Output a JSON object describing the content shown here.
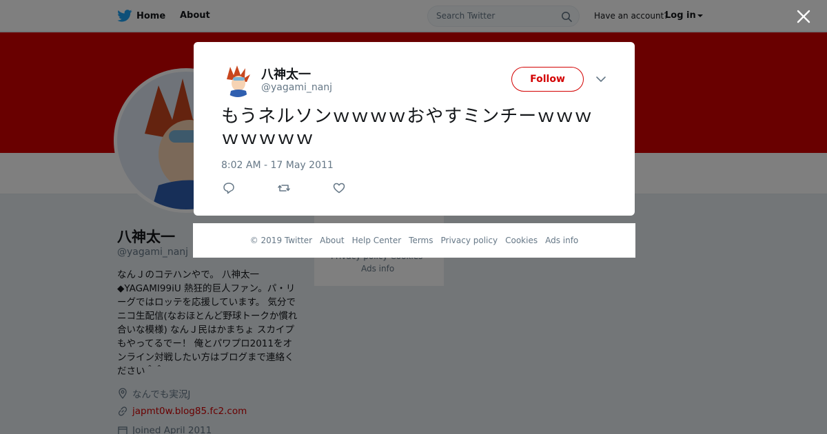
{
  "topbar": {
    "home_label": "Home",
    "about_label": "About",
    "search_placeholder": "Search Twitter",
    "have_account": "Have an account?",
    "login_label": "Log in"
  },
  "profile": {
    "name": "八神太一",
    "handle": "@yagami_nanj",
    "bio": "なんＪのコテハンやで。 八神太一◆YAGAMI99iU 熱狂的巨人ファン。パ・リーグではロッテを応援しています。 気分でニコ生配信(なおほとんど野球トークか慣れ合いな模様) なんＪ民はかまちょ スカイプもやってるでー！ 俺とパワプロ2011をオンライン対戦したい方はブログまで連絡ください＾＾",
    "location": "なんでも実況J",
    "website": "japmt0w.blog85.fc2.com",
    "joined": "Joined April 2011"
  },
  "side_card": {
    "links_line1": "Privacy policy   Cookies",
    "links_line2": "Ads info"
  },
  "tweet": {
    "name": "八神太一",
    "handle": "@yagami_nanj",
    "follow_label": "Follow",
    "text": "もうネルソンｗｗｗｗおやすミンチーｗｗｗｗｗｗｗｗ",
    "timestamp": "8:02 AM - 17 May 2011"
  },
  "footer": {
    "links": [
      "© 2019 Twitter",
      "About",
      "Help Center",
      "Terms",
      "Privacy policy",
      "Cookies",
      "Ads info"
    ]
  },
  "colors": {
    "accent": "#d30000",
    "twitter_blue": "#1da1f2",
    "secondary_text": "#657786"
  }
}
